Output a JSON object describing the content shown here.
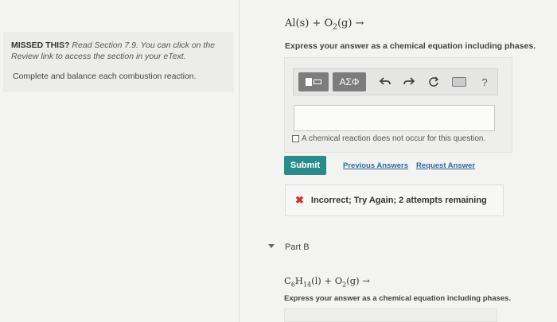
{
  "part_a": {
    "equation": {
      "al": "Al",
      "al_state": "(s)",
      "plus": " + ",
      "o": "O",
      "o_sub": "2",
      "o_state": "(g)",
      "arrow": " →"
    },
    "instruction": "Express your answer as a chemical equation including phases.",
    "toolbar": {
      "greek_label": "ΑΣΦ",
      "undo_icon": "undo-icon",
      "redo_icon": "redo-icon",
      "reset_icon": "reset-icon",
      "keyboard_icon": "keyboard-icon",
      "help_label": "?"
    },
    "answer_value": "",
    "no_reaction_label": "A chemical reaction does not occur for this question.",
    "submit_label": "Submit",
    "previous_answers_label": "Previous Answers",
    "request_answer_label": "Request Answer",
    "feedback_text": "Incorrect; Try Again; 2 attempts remaining"
  },
  "left": {
    "missed_bold": "MISSED THIS?",
    "missed_italic": " Read Section 7.9. You can click on the Review link to access the section in your eText.",
    "instruction": "Complete and balance each combustion reaction."
  },
  "part_b": {
    "label": "Part B",
    "equation": {
      "c": "C",
      "c_sub": "6",
      "h": "H",
      "h_sub": "14",
      "c_state": "(l)",
      "plus": " + ",
      "o": "O",
      "o_sub": "2",
      "o_state": "(g)",
      "arrow": " →"
    },
    "instruction": "Express your answer as a chemical equation including phases."
  },
  "colors": {
    "submit": "#2a8b8b",
    "link": "#2c6aa0",
    "error": "#d0312d"
  }
}
